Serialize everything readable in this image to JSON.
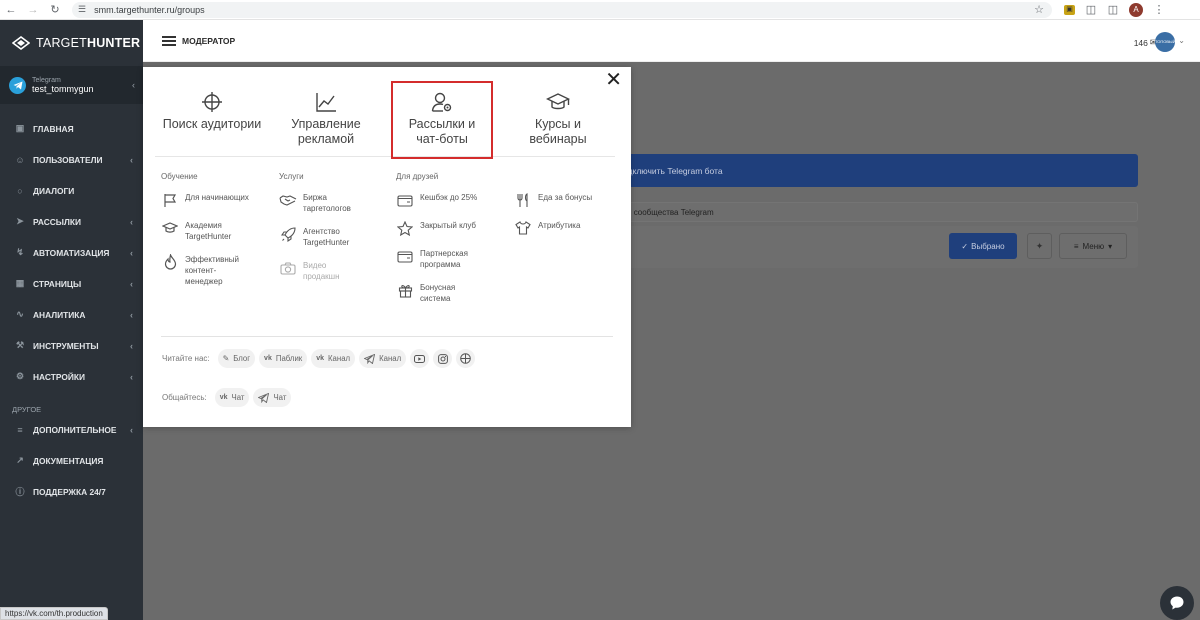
{
  "browser": {
    "url": "smm.targethunter.ru/groups",
    "profile_letter": "A",
    "status_url": "https://vk.com/th.production"
  },
  "sidebar": {
    "brand_light": "TARGET",
    "brand_bold": "HUNTER",
    "account": {
      "network": "Telegram",
      "name": "test_tommygun"
    },
    "items": [
      {
        "label": "ГЛАВНАЯ",
        "icon": "home-icon"
      },
      {
        "label": "ПОЛЬЗОВАТЕЛИ",
        "icon": "users-icon"
      },
      {
        "label": "ДИАЛОГИ",
        "icon": "chat-icon"
      },
      {
        "label": "РАССЫЛКИ",
        "icon": "send-icon"
      },
      {
        "label": "АВТОМАТИЗАЦИЯ",
        "icon": "bolt-icon"
      },
      {
        "label": "СТРАНИЦЫ",
        "icon": "pages-icon"
      },
      {
        "label": "АНАЛИТИКА",
        "icon": "analytics-icon"
      },
      {
        "label": "ИНСТРУМЕНТЫ",
        "icon": "tools-icon"
      },
      {
        "label": "НАСТРОЙКИ",
        "icon": "settings-icon"
      }
    ],
    "other_section": "ДРУГОЕ",
    "other_items": [
      {
        "label": "ДОПОЛНИТЕЛЬНОЕ",
        "icon": "list-icon"
      },
      {
        "label": "ДОКУМЕНТАЦИЯ",
        "icon": "external-icon"
      },
      {
        "label": "ПОДДЕРЖКА 24/7",
        "icon": "info-icon"
      }
    ]
  },
  "topbar": {
    "role": "МОДЕРАТОР",
    "count": "146",
    "profile_text": "ТОПОВЫЙ"
  },
  "background": {
    "connect_label": "одключить Telegram бота",
    "row_label": "и сообщества Telegram",
    "selected_label": "Выбрано",
    "menu_label": "Меню"
  },
  "modal": {
    "top_categories": [
      {
        "label": "Поиск аудитории",
        "icon": "target-icon"
      },
      {
        "label": "Управление рекламой",
        "icon": "chart-line-icon"
      },
      {
        "label": "Рассылки и чат-боты",
        "icon": "user-gear-icon"
      },
      {
        "label": "Курсы и вебинары",
        "icon": "graduation-cap-icon"
      }
    ],
    "columns": {
      "learning": {
        "header": "Обучение",
        "items": [
          "Для начинающих",
          "Академия TargetHunter",
          "Эффективный контент-менеджер"
        ]
      },
      "services": {
        "header": "Услуги",
        "items": [
          "Биржа таргетологов",
          "Агентство TargetHunter",
          "Видео продакшн"
        ]
      },
      "friends": {
        "header": "Для друзей",
        "items": [
          "Кешбэк до 25%",
          "Закрытый клуб",
          "Партнерская программа",
          "Бонусная система"
        ]
      },
      "extra": {
        "items": [
          "Еда за бонусы",
          "Атрибутика"
        ]
      }
    },
    "read_label": "Читайте нас:",
    "read_links": [
      "Блог",
      "Паблик",
      "Канал",
      "Канал"
    ],
    "talk_label": "Общайтесь:",
    "talk_links": [
      "Чат",
      "Чат"
    ]
  },
  "colors": {
    "sidebar_bg": "#2b3138",
    "highlight_border": "#d42c2c",
    "telegram_blue": "#2aa0da",
    "overlay": "#6b6b6b"
  }
}
